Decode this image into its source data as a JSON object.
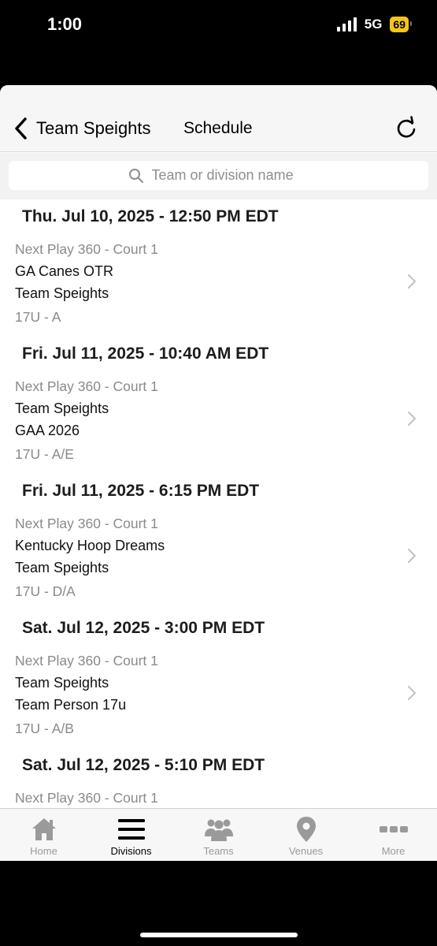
{
  "status_bar": {
    "time": "1:00",
    "network": "5G",
    "battery": "69"
  },
  "nav": {
    "back_label": "Team Speights",
    "title": "Schedule"
  },
  "search": {
    "placeholder": "Team or division name",
    "value": ""
  },
  "games": [
    {
      "date": "Thu. Jul 10, 2025 - 12:50 PM EDT",
      "venue": "Next Play 360 - Court 1",
      "team1": "GA Canes OTR",
      "team2": "Team Speights",
      "division": "17U - A"
    },
    {
      "date": "Fri. Jul 11, 2025 - 10:40 AM EDT",
      "venue": "Next Play 360 - Court 1",
      "team1": "Team Speights",
      "team2": "GAA 2026",
      "division": "17U - A/E"
    },
    {
      "date": "Fri. Jul 11, 2025 - 6:15 PM EDT",
      "venue": "Next Play 360 - Court 1",
      "team1": "Kentucky Hoop Dreams",
      "team2": "Team Speights",
      "division": "17U - D/A"
    },
    {
      "date": "Sat. Jul 12, 2025 - 3:00 PM EDT",
      "venue": "Next Play 360 - Court 1",
      "team1": "Team Speights",
      "team2": "Team Person 17u",
      "division": "17U - A/B"
    },
    {
      "date": "Sat. Jul 12, 2025 - 5:10 PM EDT",
      "venue": "Next Play 360 - Court 1",
      "team1": "",
      "team2": "",
      "division": ""
    }
  ],
  "tabs": [
    {
      "label": "Home",
      "icon": "home-icon"
    },
    {
      "label": "Divisions",
      "icon": "menu-icon"
    },
    {
      "label": "Teams",
      "icon": "people-icon"
    },
    {
      "label": "Venues",
      "icon": "location-pin-icon"
    },
    {
      "label": "More",
      "icon": "more-dots-icon"
    }
  ],
  "active_tab": "Divisions",
  "colors": {
    "battery": "#f5c518",
    "active_tab": "#000000",
    "inactive_tab": "#9a9a9a"
  }
}
